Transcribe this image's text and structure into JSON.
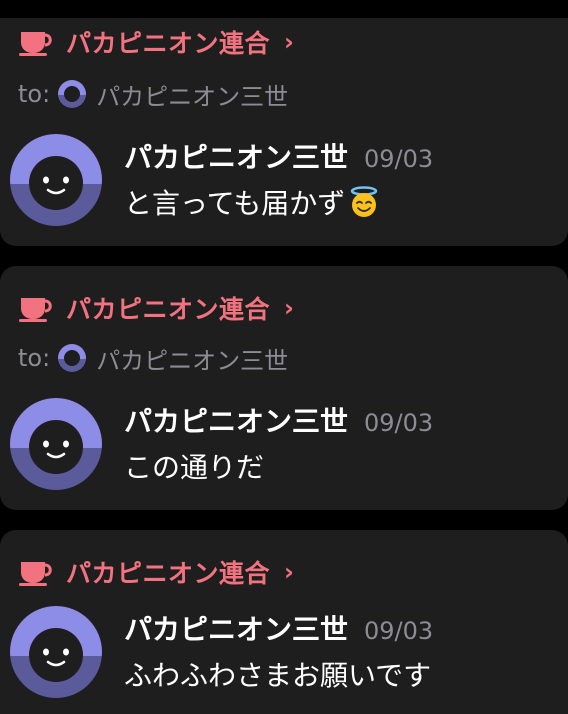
{
  "colors": {
    "background": "#000000",
    "card": "#1e1e1f",
    "server_accent": "#f2737f",
    "muted_text": "#8c8d93",
    "avatar_top": "#8d8ce6",
    "avatar_bottom": "#5b5b9c",
    "avatar_face": "#1e1e1f"
  },
  "notifications": [
    {
      "server_name": "パカピニオン連合",
      "server_icon": "teacup-icon",
      "to_label": "to:",
      "to_name": "パカピニオン三世",
      "author": "パカピニオン三世",
      "time": "09/03",
      "message": "と言っても届かず",
      "emoji": "smiling-face-with-halo-emoji"
    },
    {
      "server_name": "パカピニオン連合",
      "server_icon": "teacup-icon",
      "to_label": "to:",
      "to_name": "パカピニオン三世",
      "author": "パカピニオン三世",
      "time": "09/03",
      "message": "この通りだ"
    },
    {
      "server_name": "パカピニオン連合",
      "server_icon": "teacup-icon",
      "author": "パカピニオン三世",
      "time": "09/03",
      "message": "ふわふわさまお願いです"
    }
  ]
}
